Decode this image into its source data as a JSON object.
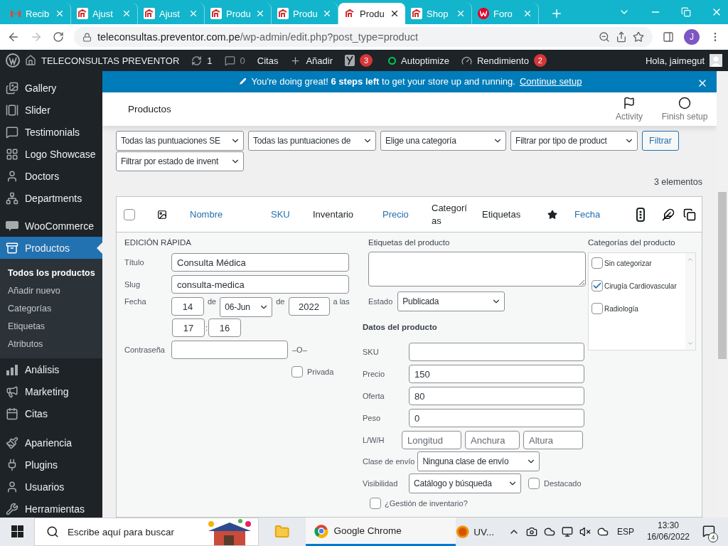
{
  "browser": {
    "tabs": [
      {
        "label": "Recib",
        "selected": false,
        "kind": "mail"
      },
      {
        "label": "Ajust",
        "selected": false,
        "kind": "site"
      },
      {
        "label": "Ajust",
        "selected": false,
        "kind": "site"
      },
      {
        "label": "Produ",
        "selected": false,
        "kind": "site"
      },
      {
        "label": "Produ",
        "selected": false,
        "kind": "site"
      },
      {
        "label": "Produ",
        "selected": true,
        "kind": "site"
      },
      {
        "label": "Shop",
        "selected": false,
        "kind": "site"
      },
      {
        "label": "Foro",
        "selected": false,
        "kind": "forum"
      }
    ],
    "url_host": "teleconsultas.preventor.com.pe",
    "url_path": "/wp-admin/edit.php?post_type=product",
    "profile": "J"
  },
  "admin_bar": {
    "site": "TELECONSULTAS PREVENTOR",
    "updates": "1",
    "comments": "0",
    "citas": "Citas",
    "add": "Añadir",
    "seo_badge": "3",
    "autoptimize": "Autoptimize",
    "performance": "Rendimiento",
    "performance_badge": "2",
    "greeting": "Hola, jaimegut"
  },
  "sidebar": {
    "groups": [
      {
        "items": [
          {
            "label": "Gallery",
            "selected": false
          },
          {
            "label": "Slider",
            "selected": false
          },
          {
            "label": "Testimonials",
            "selected": false
          },
          {
            "label": "Logo Showcase",
            "selected": false
          },
          {
            "label": "Doctors",
            "selected": false
          },
          {
            "label": "Departments",
            "selected": false
          }
        ]
      },
      {
        "items": [
          {
            "label": "WooCommerce",
            "selected": false
          },
          {
            "label": "Productos",
            "selected": true,
            "children": [
              {
                "label": "Todos los productos",
                "selected": true
              },
              {
                "label": "Añadir nuevo",
                "selected": false
              },
              {
                "label": "Categorías",
                "selected": false
              },
              {
                "label": "Etiquetas",
                "selected": false
              },
              {
                "label": "Atributos",
                "selected": false
              }
            ]
          },
          {
            "label": "Análisis",
            "selected": false
          },
          {
            "label": "Marketing",
            "selected": false
          },
          {
            "label": "Citas",
            "selected": false
          }
        ]
      },
      {
        "items": [
          {
            "label": "Apariencia",
            "selected": false
          },
          {
            "label": "Plugins",
            "selected": false
          },
          {
            "label": "Usuarios",
            "selected": false
          },
          {
            "label": "Herramientas",
            "selected": false
          }
        ]
      }
    ]
  },
  "notice": {
    "text": "You're doing great! **6 steps left** to get your store up and running.",
    "link": "Continue setup"
  },
  "header": {
    "title": "Productos",
    "actions": [
      {
        "label": "Activity"
      },
      {
        "label": "Finish setup"
      }
    ]
  },
  "filters": {
    "dropdowns": [
      "Todas las puntuaciones SE",
      "Todas las puntuaciones de",
      "Elige una categoría",
      "Filtrar por tipo de product",
      "Filtrar por estado de invent"
    ],
    "button": "Filtrar"
  },
  "count": "3 elementos",
  "table": {
    "columns": [
      {
        "kind": "checkbox",
        "checked": false
      },
      {
        "kind": "image"
      },
      {
        "kind": "text",
        "label": "Nombre",
        "sortable": true
      },
      {
        "kind": "text",
        "label": "SKU",
        "sortable": true
      },
      {
        "kind": "text",
        "label": "Inventario",
        "sortable": false
      },
      {
        "kind": "text",
        "label": "Precio",
        "sortable": true
      },
      {
        "kind": "text",
        "label": "Categorías",
        "sortable": false
      },
      {
        "kind": "text",
        "label": "Etiquetas",
        "sortable": false
      },
      {
        "kind": "star"
      },
      {
        "kind": "text",
        "label": "Fecha",
        "sortable": true
      },
      {
        "kind": "traffic"
      },
      {
        "kind": "feather"
      },
      {
        "kind": "links"
      }
    ]
  },
  "quick_edit": {
    "heading": "EDICIÓN RÁPIDA",
    "title_label": "Título",
    "title": "Consulta Médica",
    "slug_label": "Slug",
    "slug": "consulta-medica",
    "date_label": "Fecha",
    "day": "14",
    "of1": "de",
    "month": "06-Jun",
    "of2": "de",
    "year": "2022",
    "at": "a las",
    "hour": "17",
    "colon": ":",
    "minute": "16",
    "password_label": "Contraseña",
    "or": "–O–",
    "private": {
      "label": "Privada",
      "checked": false
    },
    "tags_label": "Etiquetas del producto",
    "status_label": "Estado",
    "status": "Publicada",
    "data_heading": "Datos del producto",
    "fields": [
      {
        "label": "SKU"
      },
      {
        "label": "Precio",
        "value": "150"
      },
      {
        "label": "Oferta",
        "value": "80"
      },
      {
        "label": "Peso",
        "value": "0"
      }
    ],
    "dims_label": "L/W/H",
    "dim_placeholders": [
      "Longitud",
      "Anchura",
      "Altura"
    ],
    "shipping_label": "Clase de envío",
    "shipping": "Ninguna clase de envío",
    "visibility_label": "Visibilidad",
    "visibility": "Catálogo y búsqueda",
    "featured": {
      "label": "Destacado",
      "checked": false
    },
    "stock": {
      "label": "¿Gestión de inventario?",
      "checked": false
    },
    "categories_label": "Categorías del producto",
    "categories": [
      {
        "label": "Sin categorizar",
        "checked": false
      },
      {
        "label": "Cirugía Cardiovascular",
        "checked": true
      },
      {
        "label": "Radiología",
        "checked": false
      }
    ]
  },
  "taskbar": {
    "search": "Escribe aquí para buscar",
    "app": "Google Chrome",
    "tray_app": "UV...",
    "lang": "ESP",
    "time": "13:30",
    "date": "16/06/2022",
    "notifications": "4"
  }
}
